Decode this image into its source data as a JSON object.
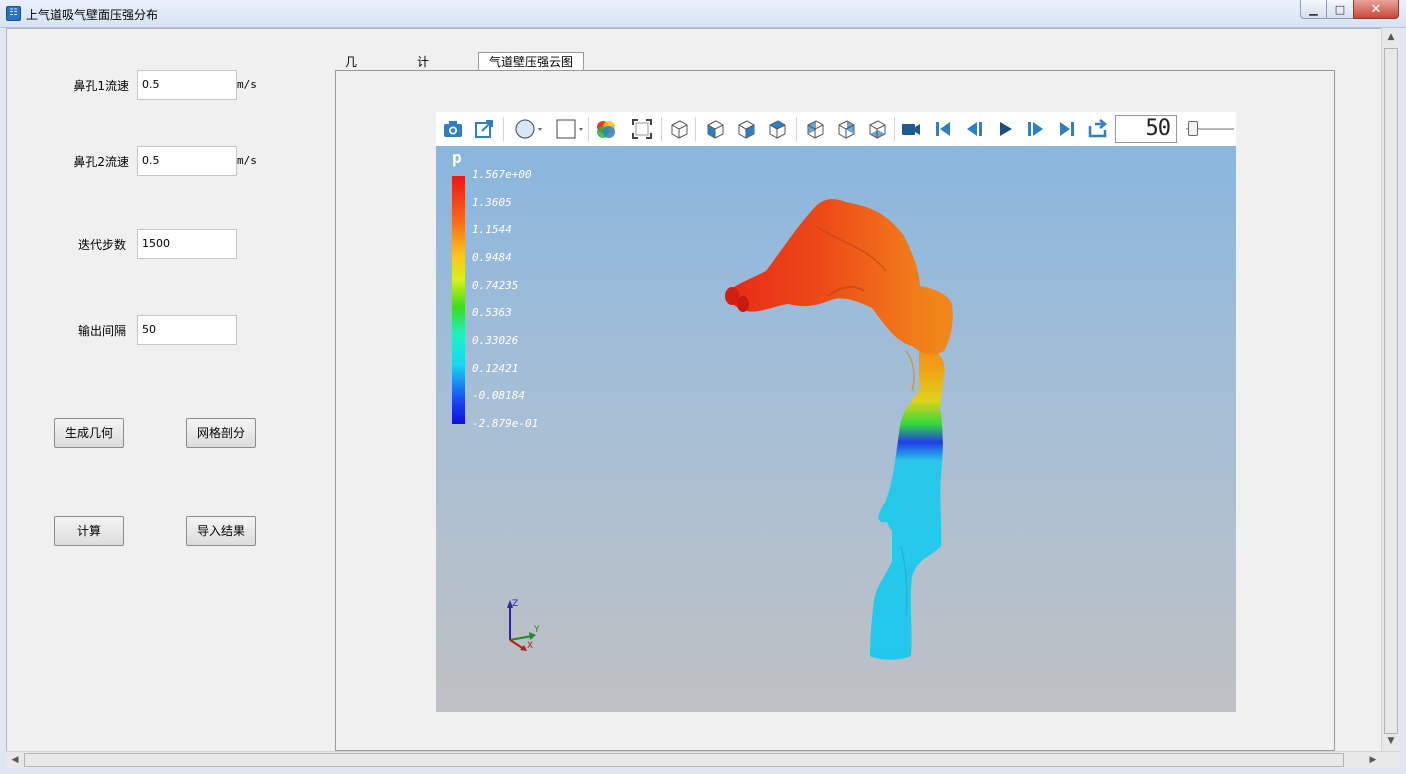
{
  "window": {
    "title": "上气道吸气壁面压强分布",
    "app_icon_glyph": "☷",
    "minimize_glyph": "▁",
    "maximize_glyph": "□",
    "close_glyph": "✕"
  },
  "form": {
    "nostril1_label": "鼻孔1流速",
    "nostril1_value": "0.5",
    "nostril1_unit": "m/s",
    "nostril2_label": "鼻孔2流速",
    "nostril2_value": "0.5",
    "nostril2_unit": "m/s",
    "iterations_label": "迭代步数",
    "iterations_value": "1500",
    "output_interval_label": "输出间隔",
    "output_interval_value": "50"
  },
  "buttons": {
    "generate_geometry": "生成几何",
    "mesh": "网格剖分",
    "compute": "计算",
    "import_results": "导入结果"
  },
  "tabs": [
    {
      "label": "几何结构",
      "active": false
    },
    {
      "label": "计算网格",
      "active": false
    },
    {
      "label": "气道壁压强云图",
      "active": true
    }
  ],
  "viewer": {
    "toolbar_icons": [
      "camera-icon",
      "export-icon",
      "sphere-select-icon",
      "box-select-icon",
      "colormap-icon",
      "fit-screen-icon",
      "view-iso-icon",
      "view-front-icon",
      "view-side-icon",
      "view-top-icon",
      "view-back-icon",
      "view-left-icon",
      "view-bottom-icon",
      "record-icon",
      "first-frame-icon",
      "prev-frame-icon",
      "play-icon",
      "next-frame-icon",
      "last-frame-icon",
      "loop-icon"
    ],
    "accent_color": "#2f7fc1",
    "frame_value": "50",
    "slider_fraction": 0.05,
    "scalar_name": "p",
    "colorbar_ticks": [
      "1.567e+00",
      "1.3605",
      "1.1544",
      "0.9484",
      "0.74235",
      "0.5363",
      "0.33026",
      "0.12421",
      "-0.08184",
      "-2.879e-01"
    ],
    "axes_labels": {
      "x": "X",
      "y": "Y",
      "z": "Z"
    }
  }
}
